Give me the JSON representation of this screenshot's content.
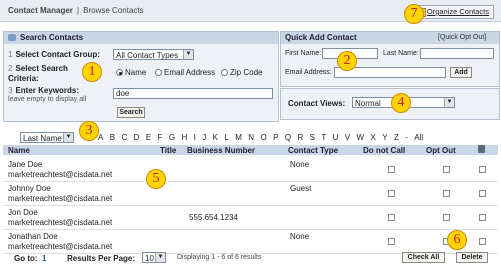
{
  "header": {
    "app_title": "Contact Manager",
    "crumb": "Browse Contacts",
    "organize_label": "Organize Contacts"
  },
  "search": {
    "title": "Search Contacts",
    "group_num": "1",
    "group_label": "Select Contact Group:",
    "group_value": "All Contact Types",
    "criteria_num": "2",
    "criteria_label": "Select Search Criteria:",
    "criteria_options": [
      "Name",
      "Email Address",
      "Zip Code"
    ],
    "criteria_selected": "Name",
    "keywords_num": "3",
    "keywords_label": "Enter Keywords:",
    "keywords_hint": "leave empty to display all",
    "keywords_value": "doe",
    "search_button": "Search"
  },
  "quick_add": {
    "title": "Quick Add Contact",
    "opt_out_link": "[Quick Opt Out]",
    "first_name_label": "First Name:",
    "last_name_label": "Last Name:",
    "email_label": "Email Address:",
    "add_button": "Add"
  },
  "contact_views": {
    "label": "Contact Views:",
    "value": "Normal"
  },
  "alphabet": {
    "sort_value": "Last Name",
    "letters": [
      "A",
      "B",
      "C",
      "D",
      "E",
      "F",
      "G",
      "H",
      "I",
      "J",
      "K",
      "L",
      "M",
      "N",
      "O",
      "P",
      "Q",
      "R",
      "S",
      "T",
      "U",
      "V",
      "W",
      "X",
      "Y",
      "Z",
      "-",
      "All"
    ]
  },
  "table": {
    "headers": {
      "name": "Name",
      "title": "Title",
      "business": "Business Number",
      "type": "Contact Type",
      "dnc": "Do not Call",
      "optout": "Opt Out"
    },
    "rows": [
      {
        "name": "Jane Doe",
        "email": "marketreachtest@cisdata.net",
        "title": "",
        "business": "",
        "type": "None"
      },
      {
        "name": "Johnny Doe",
        "email": "marketreachtest@cisdata.net",
        "title": "",
        "business": "",
        "type": "Guest"
      },
      {
        "name": "Jon Doe",
        "email": "marketreachtest@cisdata.net",
        "title": "",
        "business": "555.654.1234",
        "type": ""
      },
      {
        "name": "Jonathan Doe",
        "email": "marketreachtest@cisdata.net",
        "title": "",
        "business": "",
        "type": "None"
      }
    ]
  },
  "footer": {
    "goto_label": "Go to:",
    "goto_page": "1",
    "rpp_label": "Results Per Page:",
    "rpp_value": "10",
    "displaying": "Displaying 1 - 6 of 6 results",
    "check_all": "Check All",
    "delete": "Delete"
  },
  "callouts": [
    "1",
    "2",
    "3",
    "4",
    "5",
    "6",
    "7"
  ],
  "colors": {
    "panel_header": "#c9d6e6",
    "panel_bg": "#eef2f7",
    "callout_fill": "#ffd400",
    "callout_text": "#d02000"
  }
}
